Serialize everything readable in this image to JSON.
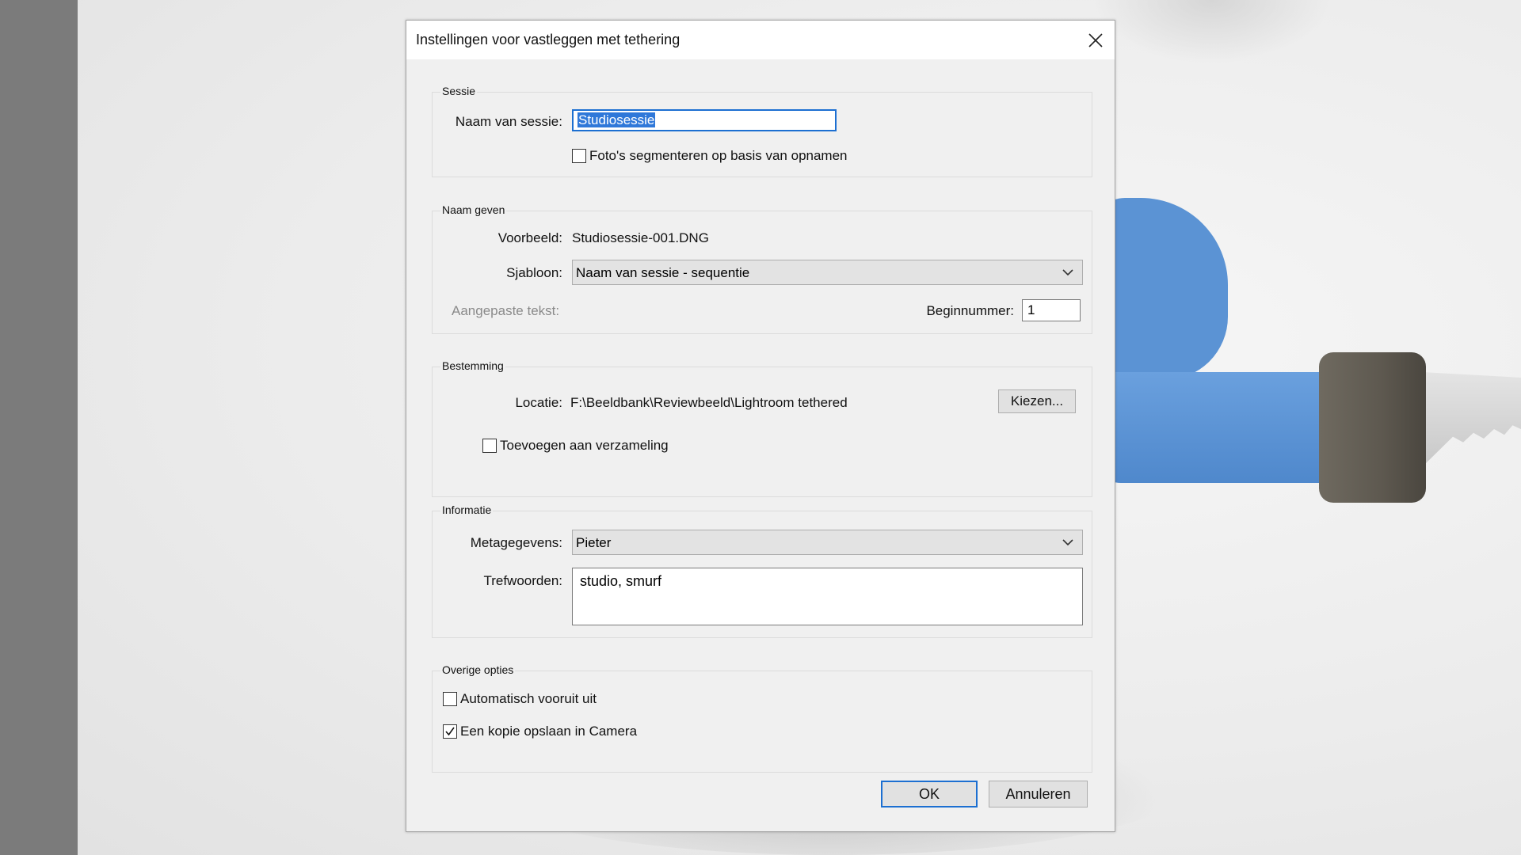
{
  "dialog": {
    "title": "Instellingen voor vastleggen met tethering",
    "close_icon": "close-icon"
  },
  "session": {
    "group_label": "Sessie",
    "name_label": "Naam van sessie:",
    "name_value": "Studiosessie",
    "segment_label": "Foto's segmenteren op basis van opnamen",
    "segment_checked": false
  },
  "naming": {
    "group_label": "Naam geven",
    "preview_label": "Voorbeeld:",
    "preview_value": "Studiosessie-001.DNG",
    "template_label": "Sjabloon:",
    "template_value": "Naam van sessie - sequentie",
    "custom_text_label": "Aangepaste tekst:",
    "start_number_label": "Beginnummer:",
    "start_number_value": "1"
  },
  "destination": {
    "group_label": "Bestemming",
    "location_label": "Locatie:",
    "location_value": "F:\\Beeldbank\\Reviewbeeld\\Lightroom tethered",
    "choose_button": "Kiezen...",
    "add_collection_label": "Toevoegen aan verzameling",
    "add_collection_checked": false
  },
  "information": {
    "group_label": "Informatie",
    "metadata_label": "Metagegevens:",
    "metadata_value": "Pieter",
    "keywords_label": "Trefwoorden:",
    "keywords_value": "studio, smurf"
  },
  "other": {
    "group_label": "Overige opties",
    "auto_advance_label": "Automatisch vooruit uit",
    "auto_advance_checked": false,
    "save_copy_label": "Een kopie opslaan in Camera",
    "save_copy_checked": true
  },
  "buttons": {
    "ok": "OK",
    "cancel": "Annuleren"
  }
}
